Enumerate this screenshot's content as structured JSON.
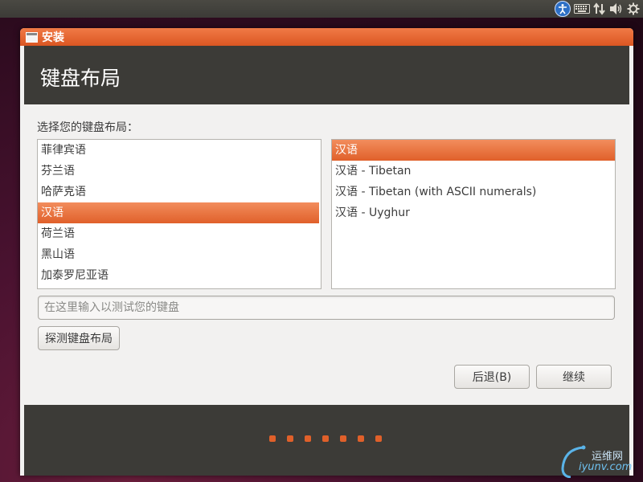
{
  "panel": {
    "icons": [
      "accessibility-icon",
      "keyboard-icon",
      "network-icon",
      "volume-icon",
      "gear-icon"
    ]
  },
  "window": {
    "title": "安装"
  },
  "header": {
    "title": "键盘布局"
  },
  "main": {
    "prompt": "选择您的键盘布局：",
    "layouts": [
      {
        "label": "菲律宾语",
        "selected": false
      },
      {
        "label": "芬兰语",
        "selected": false
      },
      {
        "label": "哈萨克语",
        "selected": false
      },
      {
        "label": "汉语",
        "selected": true
      },
      {
        "label": "荷兰语",
        "selected": false
      },
      {
        "label": "黑山语",
        "selected": false
      },
      {
        "label": "加泰罗尼亚语",
        "selected": false
      }
    ],
    "variants": [
      {
        "label": "汉语",
        "selected": true
      },
      {
        "label": "汉语 - Tibetan",
        "selected": false
      },
      {
        "label": "汉语 - Tibetan (with ASCII numerals)",
        "selected": false
      },
      {
        "label": "汉语 - Uyghur",
        "selected": false
      }
    ],
    "test_input": {
      "value": "",
      "placeholder": "在这里输入以测试您的键盘"
    },
    "detect_button": "探测键盘布局"
  },
  "buttons": {
    "back": "后退(B)",
    "continue": "继续"
  },
  "progress": {
    "total_steps": 7
  },
  "watermark": {
    "text": "运维网",
    "url": "iyunv.com"
  },
  "colors": {
    "accent": "#e0602a",
    "header_bg": "#3c3b37",
    "window_bg": "#f2f1f0"
  }
}
